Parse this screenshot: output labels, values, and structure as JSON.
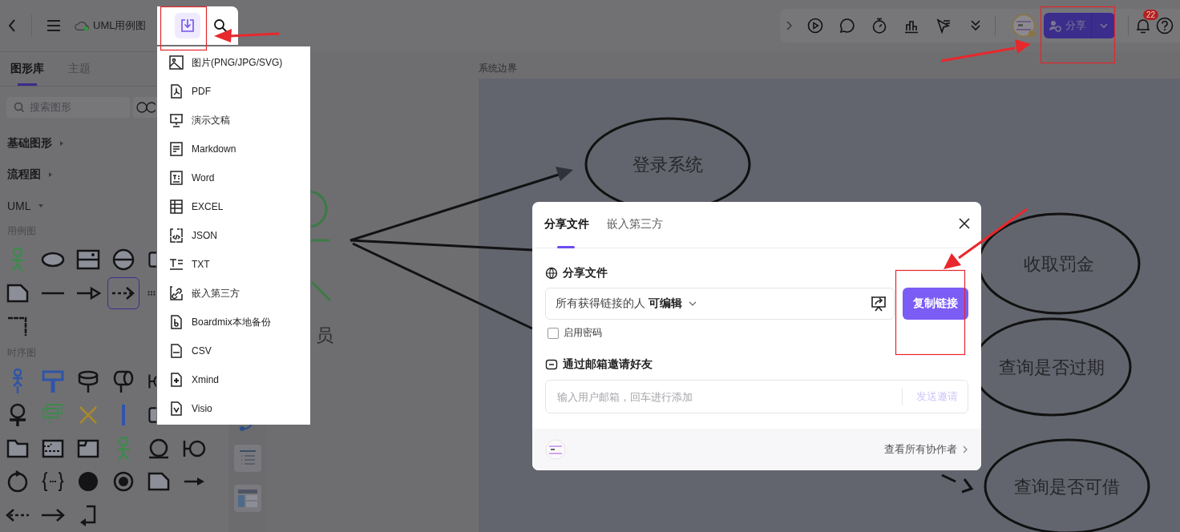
{
  "top_bar": {
    "title": "UML用例图",
    "share_label": "分享",
    "notification_count": "22"
  },
  "export_menu": [
    {
      "kind": "image",
      "label": "图片(PNG/JPG/SVG)"
    },
    {
      "kind": "pdf",
      "label": "PDF"
    },
    {
      "kind": "slides",
      "label": "演示文稿"
    },
    {
      "kind": "markdown",
      "label": "Markdown"
    },
    {
      "kind": "word",
      "label": "Word"
    },
    {
      "kind": "excel",
      "label": "EXCEL"
    },
    {
      "kind": "json",
      "label": "JSON"
    },
    {
      "kind": "txt",
      "label": "TXT"
    },
    {
      "kind": "embed",
      "label": "嵌入第三方"
    },
    {
      "kind": "boardmix",
      "label": "Boardmix本地备份"
    },
    {
      "kind": "csv",
      "label": "CSV"
    },
    {
      "kind": "xmind",
      "label": "Xmind"
    },
    {
      "kind": "visio",
      "label": "Visio"
    }
  ],
  "sidebar": {
    "tabs": [
      {
        "label": "图形库",
        "selected": true
      },
      {
        "label": "主题",
        "selected": false
      }
    ],
    "search": {
      "placeholder": "搜索图形"
    },
    "sections": [
      {
        "label": "基础图形",
        "expanded": false
      },
      {
        "label": "流程图",
        "expanded": false
      },
      {
        "label": "UML",
        "expanded": true
      }
    ],
    "groups": [
      {
        "label": "用例图",
        "rows": [
          [
            {
              "kind": "actor",
              "selected": false
            },
            {
              "kind": "ellipse",
              "selected": false
            },
            {
              "kind": "boundary-box",
              "selected": false
            },
            {
              "kind": "split-circle",
              "selected": false
            },
            {
              "kind": "block",
              "selected": false
            }
          ],
          [
            {
              "kind": "note",
              "selected": false
            },
            {
              "kind": "line",
              "selected": false
            },
            {
              "kind": "triangle-arrow",
              "selected": false
            },
            {
              "kind": "dashed-arrow",
              "selected": true
            },
            {
              "kind": "dotted-line",
              "selected": false
            }
          ],
          [
            {
              "kind": "corner",
              "selected": false
            }
          ]
        ]
      },
      {
        "label": "时序图",
        "rows": [
          [
            {
              "kind": "actor-blue",
              "selected": false
            },
            {
              "kind": "lifeline-box",
              "selected": false
            },
            {
              "kind": "database",
              "selected": false
            },
            {
              "kind": "entity-lifeline",
              "selected": false
            },
            {
              "kind": "boundary-io",
              "selected": false
            }
          ],
          [
            {
              "kind": "control",
              "selected": false
            },
            {
              "kind": "group-boxes",
              "selected": false
            },
            {
              "kind": "destroy",
              "selected": false
            },
            {
              "kind": "activation",
              "selected": false
            },
            {
              "kind": "block",
              "selected": false
            }
          ],
          [
            {
              "kind": "folder",
              "selected": false
            },
            {
              "kind": "dashed-box",
              "selected": false
            },
            {
              "kind": "frame",
              "selected": false
            },
            {
              "kind": "actor",
              "selected": false
            },
            {
              "kind": "entity",
              "selected": false
            },
            {
              "kind": "boundary-io",
              "selected": false
            }
          ],
          [
            {
              "kind": "cycle",
              "selected": false
            },
            {
              "kind": "braces",
              "selected": false
            },
            {
              "kind": "filled-circle",
              "selected": false
            },
            {
              "kind": "bullseye",
              "selected": false
            },
            {
              "kind": "note",
              "selected": false
            },
            {
              "kind": "solid-arrow",
              "selected": false
            }
          ],
          [
            {
              "kind": "dashed-back-arrow",
              "selected": false
            },
            {
              "kind": "open-arrow",
              "selected": false
            },
            {
              "kind": "return-arrow",
              "selected": false
            }
          ]
        ]
      }
    ]
  },
  "canvas": {
    "boundary_label": "系统边界",
    "actor_label": "员",
    "use_cases": [
      {
        "label": "登录系统"
      },
      {
        "label": "收取罚金"
      },
      {
        "label": "查询是否过期"
      },
      {
        "label": "查询是否可借"
      }
    ]
  },
  "share_dialog": {
    "tabs": [
      {
        "label": "分享文件",
        "selected": true
      },
      {
        "label": "嵌入第三方",
        "selected": false
      }
    ],
    "section_title": "分享文件",
    "access": "所有获得链接的人 **可编辑**",
    "copy_button": "复制链接",
    "password": {
      "label": "启用密码",
      "checked": false
    },
    "invite_title": "通过邮箱邀请好友",
    "email": {
      "placeholder": "输入用户邮箱，回车进行添加"
    },
    "send_button": {
      "label": "发送邀请",
      "disabled": true
    },
    "collaborators_link": "查看所有协作者"
  }
}
